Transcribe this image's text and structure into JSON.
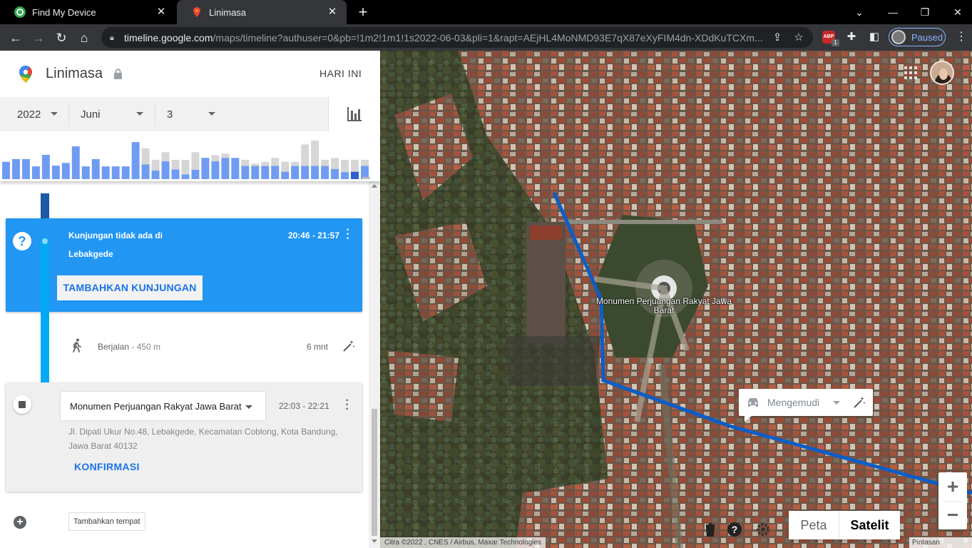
{
  "browser": {
    "tabs": [
      {
        "title": "Find My Device",
        "active": false
      },
      {
        "title": "Linimasa",
        "active": true
      }
    ],
    "url_host": "timeline.google.com",
    "url_path": "/maps/timeline?authuser=0&pb=!1m2!1m1!1s2022-06-03&pli=1&rapt=AEjHL4MoNMD93E7qX87eXyFIM4dn-XDdKuTCXm...",
    "adblock_count": "1",
    "profile_status": "Paused"
  },
  "panel": {
    "title": "Linimasa",
    "today_label": "HARI INI",
    "date": {
      "year": "2022",
      "month": "Juni",
      "day": "3"
    }
  },
  "histogram": {
    "values": [
      0.45,
      0.52,
      0.52,
      0.33,
      0.63,
      0.35,
      0.42,
      0.85,
      0.33,
      0.52,
      0.33,
      0.33,
      0.33,
      0.96,
      0.38,
      0.22,
      0.46,
      0.25,
      0.12,
      0.24,
      0.55,
      0.46,
      0.55,
      0.55,
      0.34,
      0.34,
      0.34,
      0.34,
      0.19,
      0.34,
      0.34,
      0.34,
      0.34,
      0.26,
      0.18,
      0.19,
      0.34
    ],
    "ghost": [
      0,
      0,
      0,
      0,
      0,
      0,
      0,
      0,
      0,
      0,
      0,
      0,
      0,
      0,
      0.8,
      0.5,
      0.7,
      0.5,
      0.5,
      0.7,
      0.55,
      0.62,
      0.66,
      0.5,
      0.5,
      0.4,
      0.45,
      0.55,
      0.45,
      0.45,
      0.9,
      1.0,
      0.5,
      0.55,
      0.5,
      0.5,
      0.5
    ],
    "colors": {
      "bar": "#6f9cf2",
      "ghost": "#d6d6d6",
      "selected": "#2f5fd0",
      "tick": "#bbbbbb"
    }
  },
  "timeline": {
    "unknown_visit": {
      "title": "Kunjungan tidak ada di",
      "place": "Lebakgede",
      "time": "20:46 - 21:57",
      "add_button": "TAMBAHKAN KUNJUNGAN"
    },
    "activity": {
      "label": "Berjalan",
      "distance": " - 450 m",
      "duration": "6 mnt"
    },
    "visit": {
      "place": "Monumen Perjuangan Rakyat Jawa Barat",
      "time": "22:03 - 22:21",
      "address": "Jl. Dipati Ukur No.48, Lebakgede, Kecamatan Coblong, Kota Bandung, Jawa Barat 40132",
      "confirm": "KONFIRMASI"
    },
    "add_place": "Tambahkan tempat"
  },
  "map": {
    "landmark": "Monumen Perjuangan Rakyat Jawa Barat",
    "route_mode": "Mengemudi",
    "map_type": {
      "map": "Peta",
      "satellite": "Satelit"
    },
    "attribution": "Citra ©2022 , CNES / Airbus, Maxar Technologies",
    "keyboard": "Pintasan keyboard",
    "zoom_in": "+",
    "zoom_out": "−",
    "colors": {
      "route": "#0b5ec8",
      "accent": "#2196f3"
    }
  }
}
